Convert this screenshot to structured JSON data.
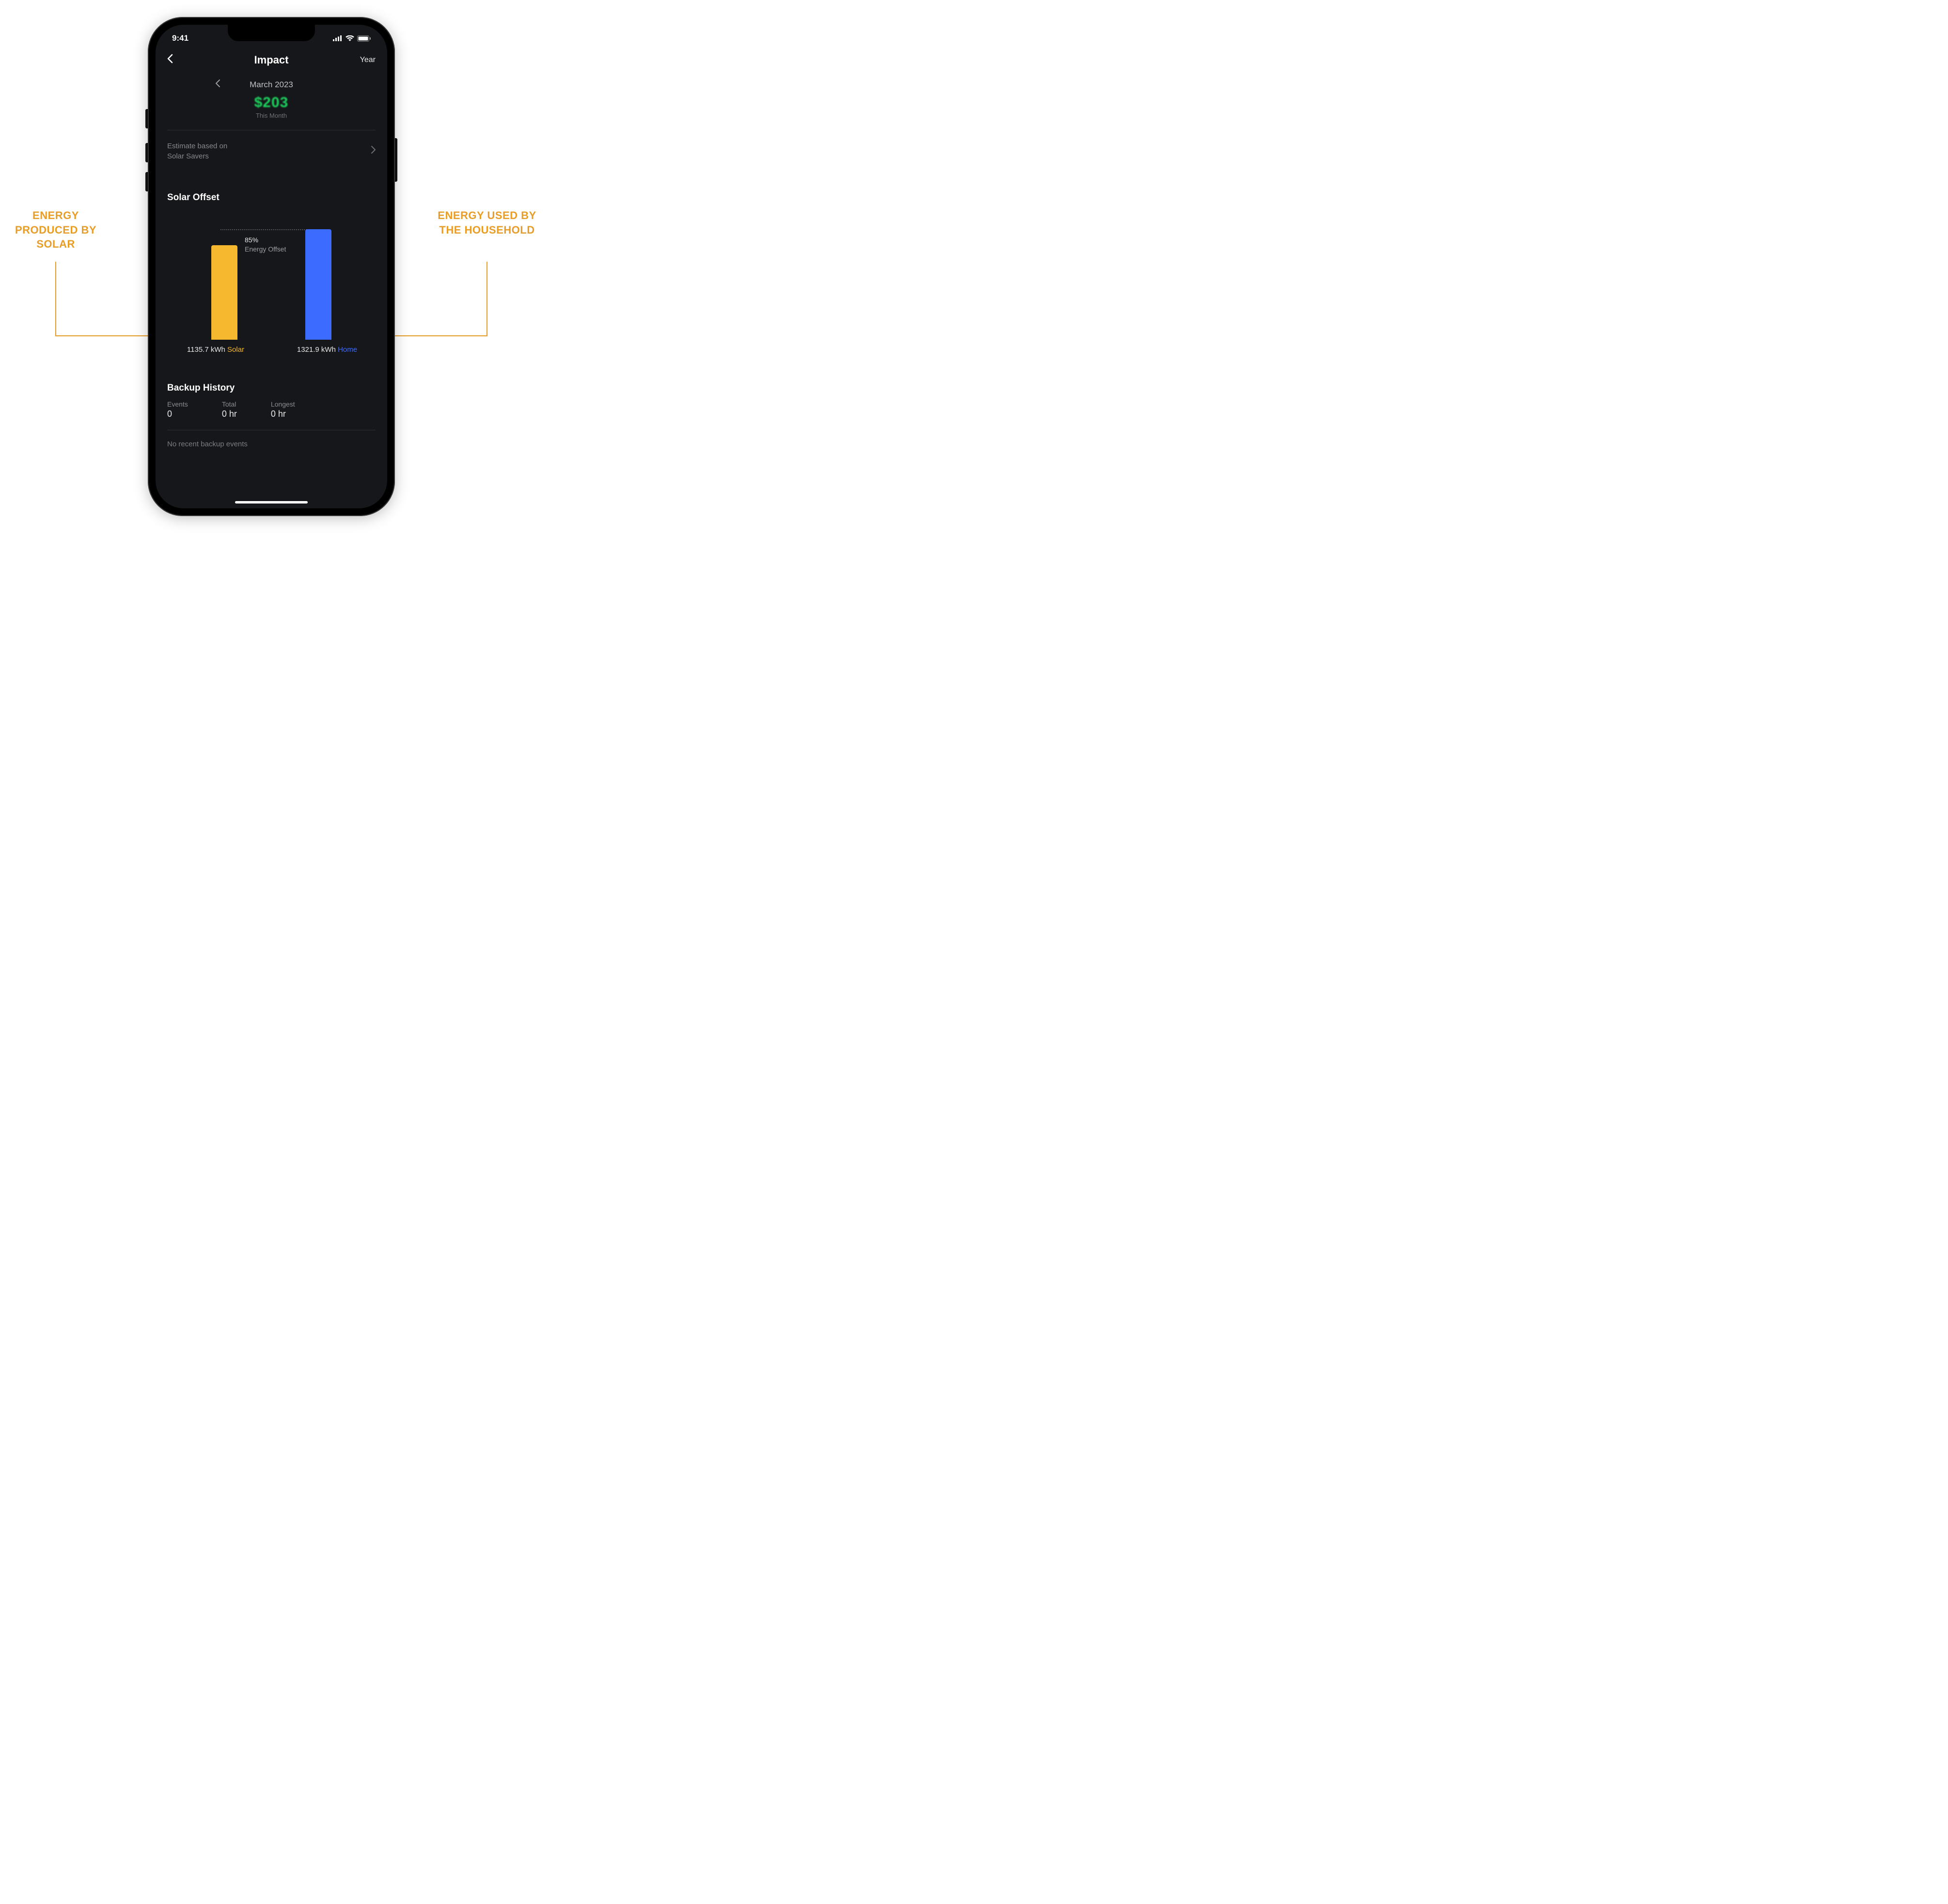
{
  "annotations": {
    "left": "ENERGY PRODUCED BY SOLAR",
    "right": "ENERGY USED BY THE HOUSEHOLD"
  },
  "status": {
    "time": "9:41"
  },
  "header": {
    "title": "Impact",
    "year_label": "Year"
  },
  "month_nav": {
    "label": "March 2023"
  },
  "savings": {
    "amount": "$203",
    "caption": "This Month"
  },
  "estimate": {
    "line1": "Estimate based on",
    "line2": "Solar Savers"
  },
  "solar_offset": {
    "title": "Solar Offset",
    "percent_label": "85%",
    "percent_caption": "Energy Offset",
    "solar": {
      "value_text": "1135.7 kWh",
      "label": "Solar"
    },
    "home": {
      "value_text": "1321.9 kWh",
      "label": "Home"
    }
  },
  "backup": {
    "title": "Backup History",
    "events_label": "Events",
    "events_value": "0",
    "total_label": "Total",
    "total_value": "0 hr",
    "longest_label": "Longest",
    "longest_value": "0 hr",
    "empty_msg": "No recent backup events"
  },
  "chart_data": {
    "type": "bar",
    "title": "Solar Offset",
    "categories": [
      "Solar",
      "Home"
    ],
    "values": [
      1135.7,
      1321.9
    ],
    "unit": "kWh",
    "series_colors": [
      "#F5B82E",
      "#3B6BFF"
    ],
    "annotation": {
      "label": "Energy Offset",
      "value_pct": 85,
      "reference_value": 1135.7
    },
    "ylim": [
      0,
      1400
    ],
    "xlabel": "",
    "ylabel": ""
  }
}
